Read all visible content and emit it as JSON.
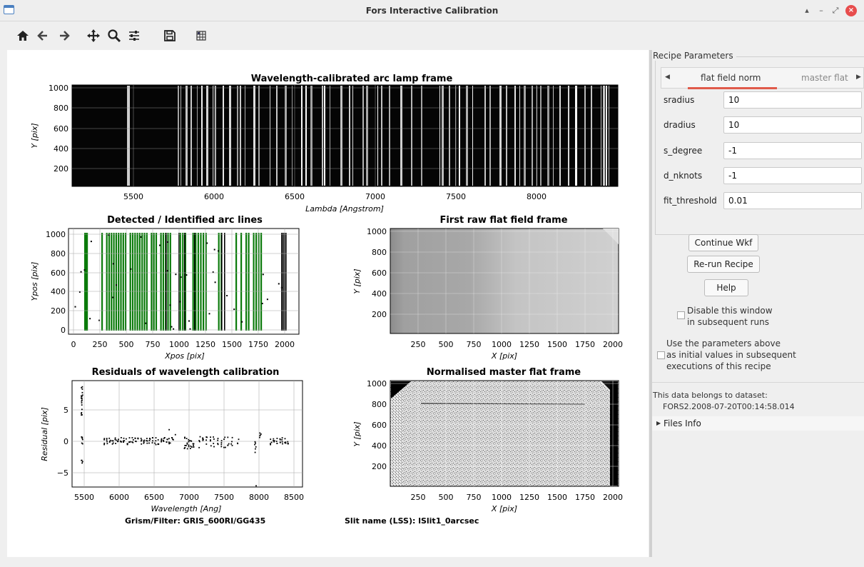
{
  "window": {
    "title": "Fors Interactive Calibration",
    "controls": [
      "minimize-icon",
      "maximize-icon",
      "restore-icon",
      "close-icon"
    ]
  },
  "toolbar": {
    "tools": [
      "home-icon",
      "back-arrow-icon",
      "forward-arrow-icon",
      "pan-icon",
      "zoom-icon",
      "configure-subplots-icon",
      "save-icon",
      "plot-layout-icon"
    ]
  },
  "plots": {
    "arc": {
      "title": "Wavelength-calibrated arc lamp frame",
      "xlabel": "Lambda [Angstrom]",
      "ylabel": "Y [pix]",
      "xticks": [
        "5500",
        "6000",
        "6500",
        "7000",
        "7500",
        "8000"
      ],
      "yticks": [
        "1000",
        "800",
        "600",
        "400",
        "200"
      ]
    },
    "detected": {
      "title": "Detected / Identified arc lines",
      "xlabel": "Xpos [pix]",
      "ylabel": "Ypos [pix]",
      "xticks": [
        "0",
        "250",
        "500",
        "750",
        "1000",
        "1250",
        "1500",
        "1750",
        "2000"
      ],
      "yticks": [
        "1000",
        "800",
        "600",
        "400",
        "200",
        "0"
      ]
    },
    "rawflat": {
      "title": "First raw flat field frame",
      "xlabel": "X [pix]",
      "ylabel": "Y [pix]",
      "xticks": [
        "250",
        "500",
        "750",
        "1000",
        "1250",
        "1500",
        "1750",
        "2000"
      ],
      "yticks": [
        "1000",
        "800",
        "600",
        "400",
        "200"
      ]
    },
    "residuals": {
      "title": "Residuals of wavelength calibration",
      "xlabel": "Wavelength [Ang]",
      "ylabel": "Residual [pix]",
      "xticks": [
        "5500",
        "6000",
        "6500",
        "7000",
        "7500",
        "8000",
        "8500"
      ],
      "yticks": [
        "5",
        "0",
        "−5"
      ]
    },
    "masterflat": {
      "title": "Normalised master flat frame",
      "xlabel": "X [pix]",
      "ylabel": "Y [pix]",
      "xticks": [
        "250",
        "500",
        "750",
        "1000",
        "1250",
        "1500",
        "1750",
        "2000"
      ],
      "yticks": [
        "1000",
        "800",
        "600",
        "400",
        "200"
      ]
    }
  },
  "footer": {
    "grism": "Grism/Filter: GRIS_600RI/GG435",
    "slit": "Slit name (LSS): lSlit1_0arcsec"
  },
  "recipe": {
    "group_title": "Recipe Parameters",
    "tabs": [
      "flat field norm",
      "master flat"
    ],
    "active_tab": "flat field norm",
    "params": [
      {
        "label": "sradius",
        "value": "10"
      },
      {
        "label": "dradius",
        "value": "10"
      },
      {
        "label": "s_degree",
        "value": "-1"
      },
      {
        "label": "d_nknots",
        "value": "-1"
      },
      {
        "label": "fit_threshold",
        "value": "0.01"
      }
    ]
  },
  "actions": {
    "continue": "Continue Wkf",
    "rerun": "Re-run Recipe",
    "help": "Help",
    "disable_line1": "Disable this window",
    "disable_line2": "in subsequent runs",
    "use_line1": "Use the parameters above",
    "use_line2": "as initial values in subsequent",
    "use_line3": "executions of this recipe"
  },
  "dataset": {
    "label": "This data belongs to dataset:",
    "name": "FORS2.2008-07-20T00:14:58.014",
    "files_info": "Files Info"
  },
  "colors": {
    "identified_lines": "#0a7a0a",
    "detected_lines": "#000000",
    "active_tab_underline": "#e05a4a",
    "close_button": "#e74c4c"
  }
}
